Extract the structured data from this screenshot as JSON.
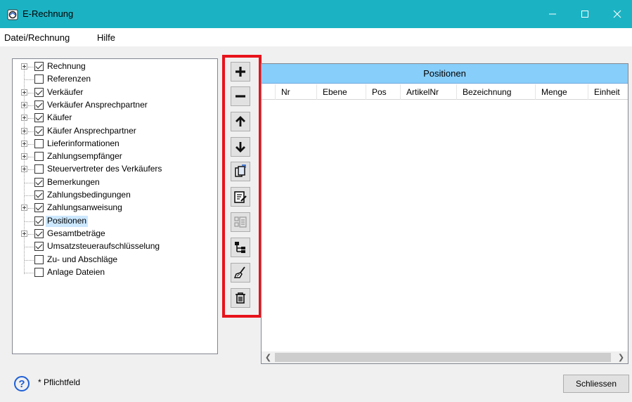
{
  "window": {
    "title": "E-Rechnung"
  },
  "menu": {
    "items": [
      "Datei/Rechnung",
      "Hilfe"
    ]
  },
  "tree": {
    "items": [
      {
        "label": "Rechnung",
        "checked": true,
        "expandable": true,
        "selected": false
      },
      {
        "label": "Referenzen",
        "checked": false,
        "expandable": false,
        "selected": false
      },
      {
        "label": "Verkäufer",
        "checked": true,
        "expandable": true,
        "selected": false
      },
      {
        "label": "Verkäufer Ansprechpartner",
        "checked": true,
        "expandable": true,
        "selected": false
      },
      {
        "label": "Käufer",
        "checked": true,
        "expandable": true,
        "selected": false
      },
      {
        "label": "Käufer Ansprechpartner",
        "checked": true,
        "expandable": true,
        "selected": false
      },
      {
        "label": "Lieferinformationen",
        "checked": false,
        "expandable": true,
        "selected": false
      },
      {
        "label": "Zahlungsempfänger",
        "checked": false,
        "expandable": true,
        "selected": false
      },
      {
        "label": "Steuervertreter des Verkäufers",
        "checked": false,
        "expandable": true,
        "selected": false
      },
      {
        "label": "Bemerkungen",
        "checked": true,
        "expandable": false,
        "selected": false
      },
      {
        "label": "Zahlungsbedingungen",
        "checked": true,
        "expandable": false,
        "selected": false
      },
      {
        "label": "Zahlungsanweisung",
        "checked": true,
        "expandable": true,
        "selected": false
      },
      {
        "label": "Positionen",
        "checked": true,
        "expandable": false,
        "selected": true
      },
      {
        "label": "Gesamtbeträge",
        "checked": true,
        "expandable": true,
        "selected": false
      },
      {
        "label": "Umsatzsteueraufschlüsselung",
        "checked": true,
        "expandable": false,
        "selected": false
      },
      {
        "label": "Zu- und Abschläge",
        "checked": false,
        "expandable": false,
        "selected": false
      },
      {
        "label": "Anlage Dateien",
        "checked": false,
        "expandable": false,
        "selected": false
      }
    ]
  },
  "toolbar": {
    "buttons": [
      "plus-icon",
      "minus-icon",
      "arrow-up-icon",
      "arrow-down-icon",
      "copy-icon",
      "edit-icon",
      "list-icon",
      "hierarchy-icon",
      "broom-icon",
      "trash-icon"
    ],
    "highlight_color": "#e8131b"
  },
  "grid": {
    "title": "Positionen",
    "columns": [
      "Nr",
      "Ebene",
      "Pos",
      "ArtikelNr",
      "Bezeichnung",
      "Menge",
      "Einheit"
    ],
    "rows": []
  },
  "footer": {
    "help_icon": "?",
    "pflichtfeld": "* Pflichtfeld",
    "close_label": "Schliessen"
  },
  "colors": {
    "titlebar": "#1bb3c4",
    "grid_title": "#87cefa",
    "selection": "#cce8ff"
  }
}
